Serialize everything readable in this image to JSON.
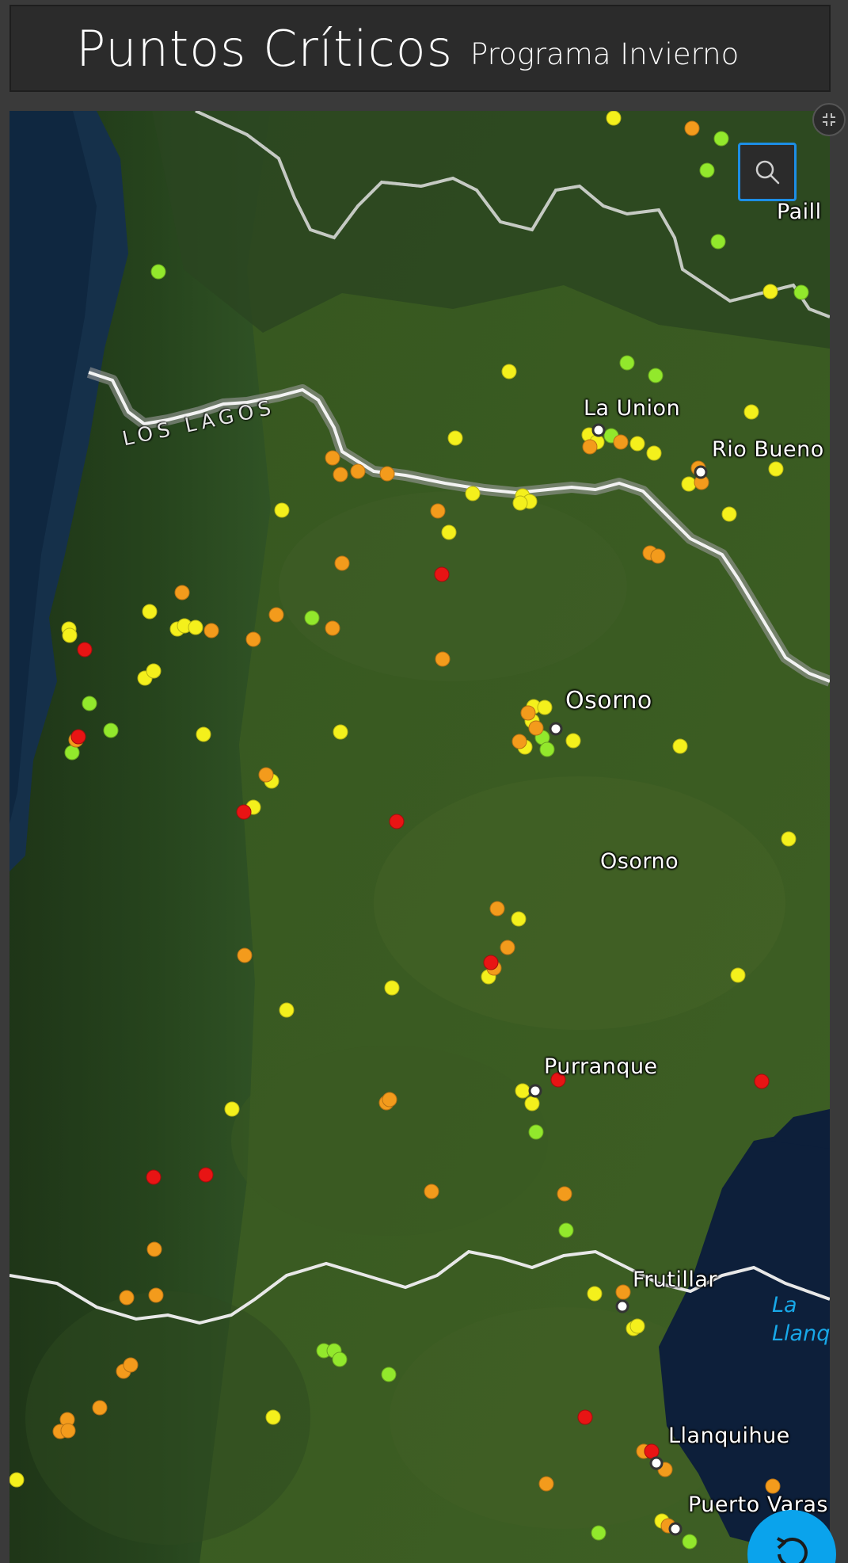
{
  "header": {
    "title": "Puntos Críticos",
    "subtitle": "Programa Invierno"
  },
  "map": {
    "region_label": "LOS LAGOS",
    "cities": [
      {
        "name": "La Union",
        "major": false
      },
      {
        "name": "Rio Bueno",
        "major": false
      },
      {
        "name": "Osorno",
        "major": true
      },
      {
        "name": "Osorno",
        "major": false
      },
      {
        "name": "Purranque",
        "major": false
      },
      {
        "name": "Frutillar",
        "major": false
      },
      {
        "name": "Llanquihue",
        "major": false
      },
      {
        "name": "Puerto Varas",
        "major": false
      },
      {
        "name": "Paill",
        "major": false
      }
    ],
    "water_label": "La\nLlanq",
    "legend_colors": {
      "critical": "#e81414",
      "high": "#f39b1c",
      "medium": "#f4f01c",
      "low": "#92e82c"
    }
  },
  "controls": {
    "search_icon": "search-icon",
    "collapse_icon": "collapse-icon",
    "refresh_icon": "refresh-icon"
  }
}
